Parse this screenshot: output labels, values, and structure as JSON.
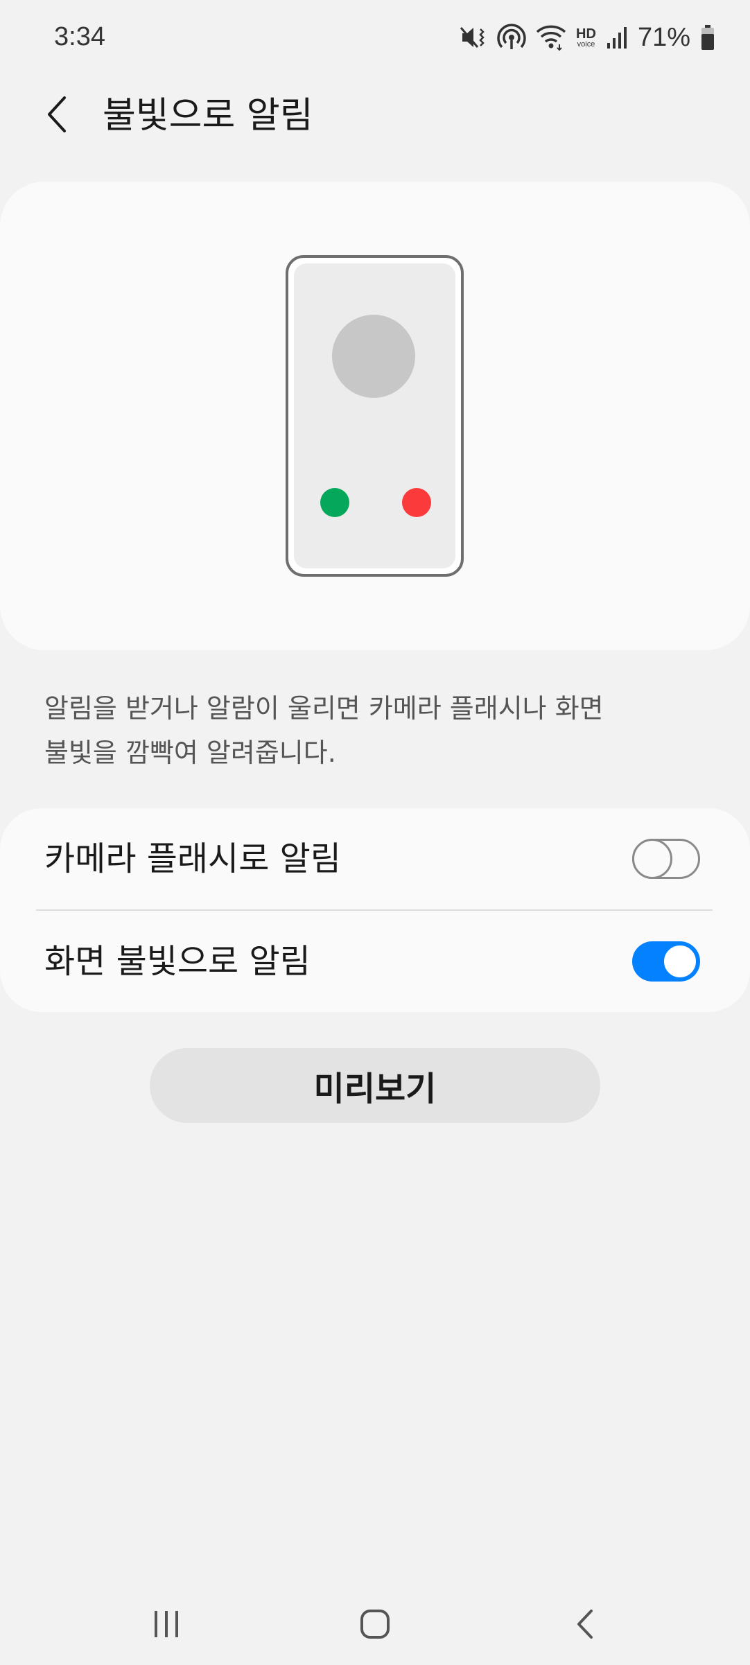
{
  "status_bar": {
    "time": "3:34",
    "hd_label": "HD",
    "voice_label": "voice",
    "battery_percent": "71%",
    "icons": [
      "mute-vibrate-icon",
      "hotspot-icon",
      "wifi-icon",
      "hd-voice-icon",
      "signal-icon",
      "battery-icon"
    ]
  },
  "header": {
    "title": "불빛으로 알림",
    "back_icon": "chevron-left-icon"
  },
  "illustration": {
    "accept_color": "#05a85a",
    "decline_color": "#fb3b3b",
    "avatar_color": "#c7c7c7"
  },
  "description": {
    "line1": "알림을 받거나 알람이 울리면 카메라 플래시나 화면",
    "line2": "불빛을 깜빡여 알려줍니다."
  },
  "settings": {
    "camera_flash": {
      "label": "카메라 플래시로 알림",
      "enabled": false
    },
    "screen_flash": {
      "label": "화면 불빛으로 알림",
      "enabled": true
    },
    "accent_color": "#0381fe"
  },
  "preview_button": {
    "label": "미리보기"
  },
  "nav_bar": {
    "icons": [
      "recents-icon",
      "home-icon",
      "back-icon"
    ]
  }
}
